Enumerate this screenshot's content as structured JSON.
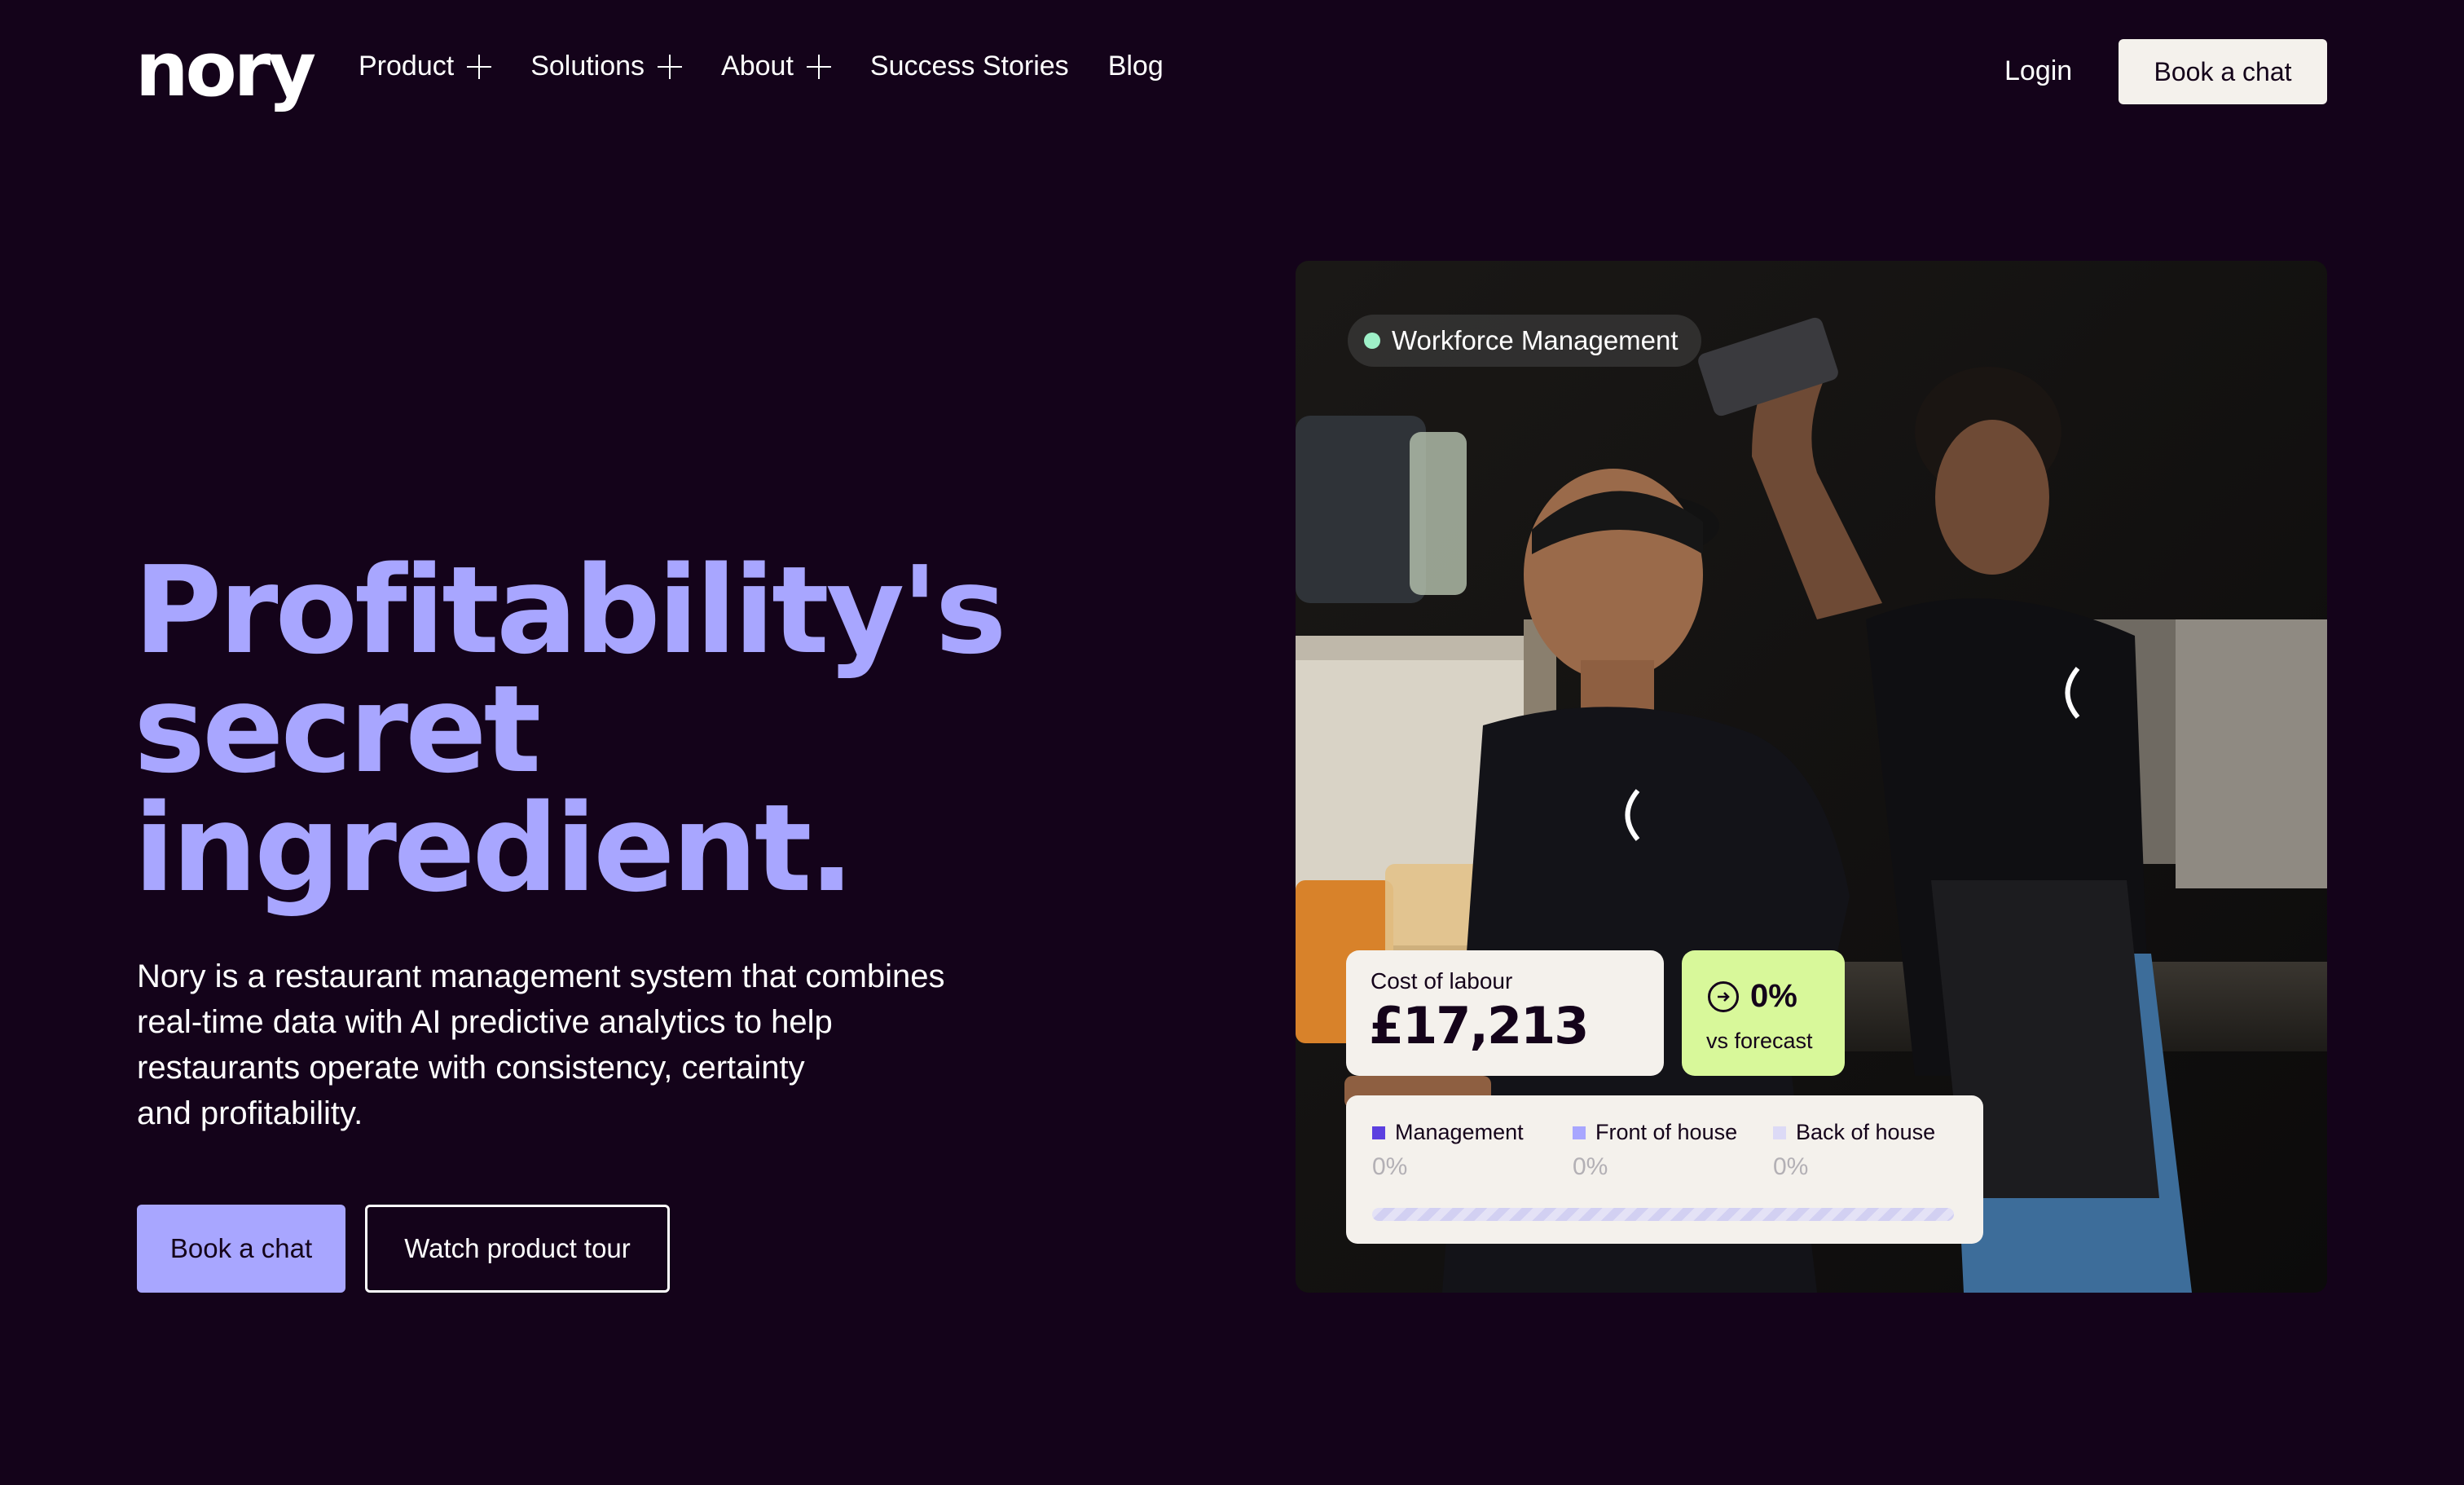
{
  "brand": {
    "logo_text": "nory"
  },
  "nav": {
    "items": [
      {
        "label": "Product",
        "has_submenu": true
      },
      {
        "label": "Solutions",
        "has_submenu": true
      },
      {
        "label": "About",
        "has_submenu": true
      },
      {
        "label": "Success Stories",
        "has_submenu": false
      },
      {
        "label": "Blog",
        "has_submenu": false
      }
    ],
    "login_label": "Login",
    "cta_label": "Book a chat"
  },
  "hero": {
    "headline_lines": [
      "Profitability's",
      "secret",
      "ingredient."
    ],
    "description_lines": [
      "Nory is a restaurant management system that combines",
      "real-time data with AI predictive analytics to help",
      "restaurants operate with consistency, certainty",
      "and profitability."
    ],
    "primary_button": "Book a chat",
    "secondary_button": "Watch product tour"
  },
  "showcase": {
    "tag_label": "Workforce Management",
    "cost_card": {
      "label": "Cost of labour",
      "value": "£17,213"
    },
    "forecast_card": {
      "value": "0%",
      "label": "vs forecast"
    },
    "breakdown": [
      {
        "label": "Management",
        "value": "0%",
        "color": "#5b3fe0"
      },
      {
        "label": "Front of house",
        "value": "0%",
        "color": "#a8a6ff"
      },
      {
        "label": "Back of house",
        "value": "0%",
        "color": "#dcdaf6"
      }
    ]
  },
  "colors": {
    "background": "#14031a",
    "accent": "#a8a6ff",
    "cream": "#f4f1ec",
    "lime": "#d8f89a",
    "status_dot": "#9ef0c8"
  }
}
